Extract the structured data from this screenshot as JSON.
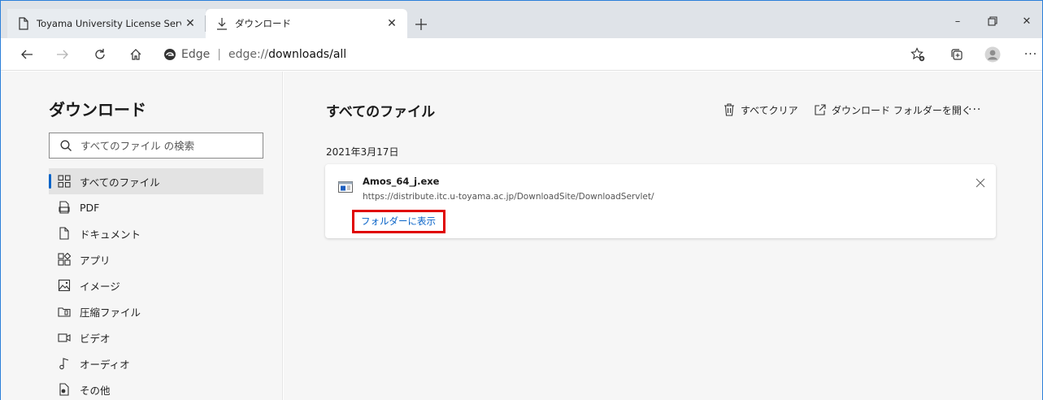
{
  "tabs": [
    {
      "label": "Toyama University License Server",
      "icon": "page-icon",
      "close": "✕"
    },
    {
      "label": "ダウンロード",
      "icon": "download-icon",
      "close": "✕"
    }
  ],
  "window_controls": {
    "minimize": "–",
    "restore": "⧉",
    "close": "✕"
  },
  "address_bar": {
    "chip_label": "Edge",
    "separator": "|",
    "url_scheme": "edge://",
    "url_path": "downloads/all"
  },
  "sidebar": {
    "title": "ダウンロード",
    "search_placeholder": "すべてのファイル の検索",
    "items": [
      {
        "label": "すべてのファイル",
        "icon": "grid-icon",
        "selected": true
      },
      {
        "label": "PDF",
        "icon": "pdf-icon"
      },
      {
        "label": "ドキュメント",
        "icon": "document-icon"
      },
      {
        "label": "アプリ",
        "icon": "apps-icon"
      },
      {
        "label": "イメージ",
        "icon": "image-icon"
      },
      {
        "label": "圧縮ファイル",
        "icon": "archive-icon"
      },
      {
        "label": "ビデオ",
        "icon": "video-icon"
      },
      {
        "label": "オーディオ",
        "icon": "audio-icon"
      },
      {
        "label": "その他",
        "icon": "other-icon"
      }
    ]
  },
  "main": {
    "title": "すべてのファイル",
    "clear_all_label": "すべてクリア",
    "open_folder_label": "ダウンロード フォルダーを開く",
    "more_label": "···",
    "date_heading": "2021年3月17日",
    "download": {
      "file_name": "Amos_64_j.exe",
      "source_url": "https://distribute.itc.u-toyama.ac.jp/DownloadSite/DownloadServlet/",
      "show_in_folder_label": "フォルダーに表示"
    }
  },
  "colors": {
    "accent": "#0a64c8",
    "highlight_box": "#e00000",
    "window_border": "#2b7fd9"
  }
}
